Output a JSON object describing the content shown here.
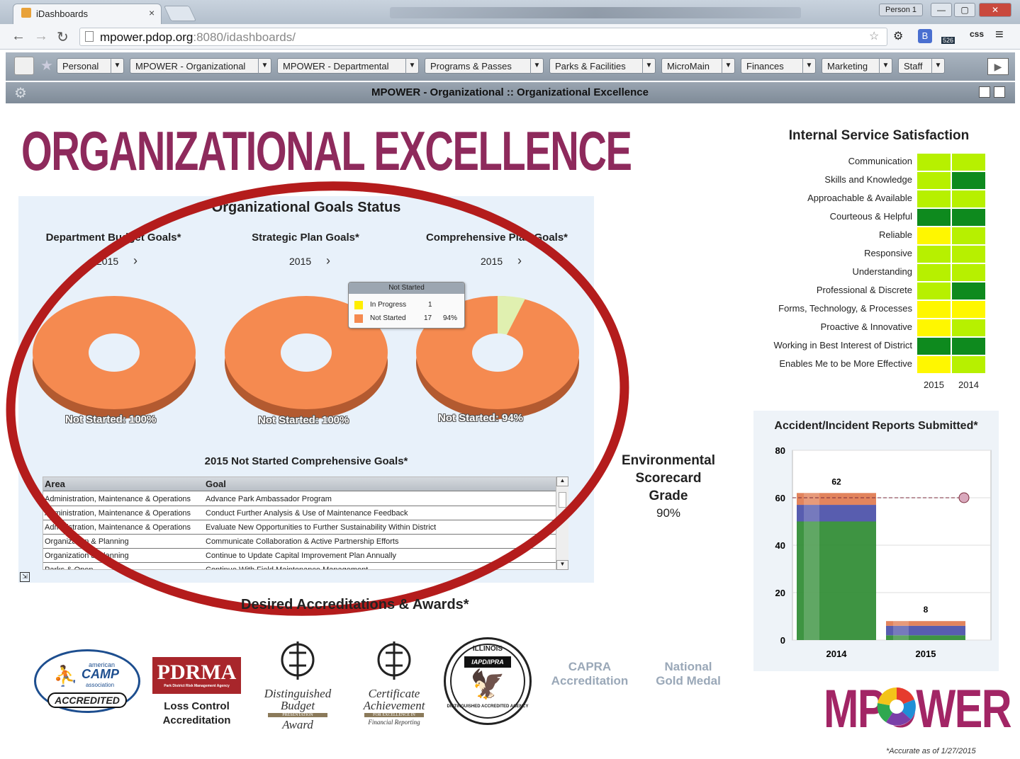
{
  "browser": {
    "tab_title": "iDashboards",
    "tab_close": "×",
    "person": "Person 1",
    "url_host": "mpower.pdop.org",
    "url_rest": ":8080/idashboards/",
    "ext_css": "css",
    "ext_badge": "526"
  },
  "toolbar": {
    "tabs": [
      "Personal",
      "MPOWER - Organizational",
      "MPOWER - Departmental",
      "Programs & Passes",
      "Parks & Facilities",
      "MicroMain",
      "Finances",
      "Marketing",
      "Staff"
    ],
    "subtitle": "MPOWER - Organizational :: Organizational Excellence"
  },
  "headline": "ORGANIZATIONAL EXCELLENCE",
  "goals": {
    "title": "Organizational Goals Status",
    "sections": [
      {
        "name": "Department Budget Goals*",
        "year": "2015",
        "label": "Not Started: 100%"
      },
      {
        "name": "Strategic Plan Goals*",
        "year": "2015",
        "label": "Not Started: 100%"
      },
      {
        "name": "Comprehensive Plan Goals*",
        "year": "2015",
        "label": "Not Started: 94%"
      }
    ],
    "tooltip": {
      "title": "Not Started",
      "rows": [
        {
          "label": "In Progress",
          "count": "1",
          "pct": ""
        },
        {
          "label": "Not Started",
          "count": "17",
          "pct": "94%"
        }
      ]
    },
    "table_title": "2015 Not Started Comprehensive Goals*",
    "columns": [
      "Area",
      "Goal"
    ],
    "rows": [
      [
        "Administration, Maintenance & Operations",
        "Advance Park Ambassador Program"
      ],
      [
        "Administration, Maintenance & Operations",
        "Conduct Further Analysis & Use of Maintenance Feedback"
      ],
      [
        "Administration, Maintenance & Operations",
        "Evaluate New Opportunities to Further Sustainability Within District"
      ],
      [
        "Organization & Planning",
        "Communicate Collaboration & Active Partnership Efforts"
      ],
      [
        "Organization & Planning",
        "Continue to Update Capital Improvement Plan Annually"
      ],
      [
        "Parks & Open...",
        "Continue With Field Maintenance Management"
      ]
    ]
  },
  "environmental": {
    "title_lines": [
      "Environmental",
      "Scorecard",
      "Grade"
    ],
    "value": "90%"
  },
  "satisfaction": {
    "title": "Internal Service Satisfaction",
    "years": [
      "2015",
      "2014"
    ],
    "colors": {
      "dark_green": "#0e8a1e",
      "light_green": "#b7f000",
      "yellow": "#fff700"
    },
    "rows": [
      {
        "label": "Communication",
        "v2015": "light_green",
        "v2014": "light_green"
      },
      {
        "label": "Skills and Knowledge",
        "v2015": "light_green",
        "v2014": "dark_green"
      },
      {
        "label": "Approachable & Available",
        "v2015": "light_green",
        "v2014": "light_green"
      },
      {
        "label": "Courteous & Helpful",
        "v2015": "dark_green",
        "v2014": "dark_green"
      },
      {
        "label": "Reliable",
        "v2015": "yellow",
        "v2014": "light_green"
      },
      {
        "label": "Responsive",
        "v2015": "light_green",
        "v2014": "light_green"
      },
      {
        "label": "Understanding",
        "v2015": "light_green",
        "v2014": "light_green"
      },
      {
        "label": "Professional & Discrete",
        "v2015": "light_green",
        "v2014": "dark_green"
      },
      {
        "label": "Forms, Technology, & Processes",
        "v2015": "yellow",
        "v2014": "yellow"
      },
      {
        "label": "Proactive & Innovative",
        "v2015": "yellow",
        "v2014": "light_green"
      },
      {
        "label": "Working in Best Interest of District",
        "v2015": "dark_green",
        "v2014": "dark_green"
      },
      {
        "label": "Enables Me to be More Effective",
        "v2015": "yellow",
        "v2014": "light_green"
      }
    ]
  },
  "chart_data": {
    "type": "bar",
    "title": "Accident/Incident Reports Submitted*",
    "categories": [
      "2014",
      "2015"
    ],
    "stacked": true,
    "series": [
      {
        "values": [
          50,
          2
        ],
        "color": "#2e8b32"
      },
      {
        "values": [
          7,
          4
        ],
        "color": "#4a4fa8"
      },
      {
        "values": [
          5,
          2
        ],
        "color": "#e07a4f"
      }
    ],
    "totals": [
      62,
      8
    ],
    "target": 60,
    "ylim": [
      0,
      80
    ],
    "yticks": [
      0,
      20,
      40,
      60,
      80
    ]
  },
  "awards": {
    "title": "Desired Accreditations & Awards*",
    "aca_top": "american",
    "aca_name": "CAMP",
    "aca_bottom": "association",
    "aca_badge": "ACCREDITED",
    "pdrma": "PDRMA",
    "pdrma_sub": "Park District Risk Management Agency",
    "pdrma_caption": [
      "Loss Control",
      "Accreditation"
    ],
    "gfoa1": [
      "Distinguished",
      "Budget",
      "PRESENTATION",
      "Award"
    ],
    "gfoa2": [
      "Certificate",
      "Achievement",
      "FOR EXCELLENCE IN",
      "Financial Reporting"
    ],
    "ilseal_top": "ILLINOIS",
    "ilseal_mid": "IAPD/IPRA",
    "ilseal_ring": "DISTINGUISHED ACCREDITED AGENCY",
    "capra": [
      "CAPRA",
      "Accreditation"
    ],
    "gold": [
      "National",
      "Gold Medal"
    ]
  },
  "brand": "MPOWER",
  "footer_note": "*Accurate as of 1/27/2015"
}
